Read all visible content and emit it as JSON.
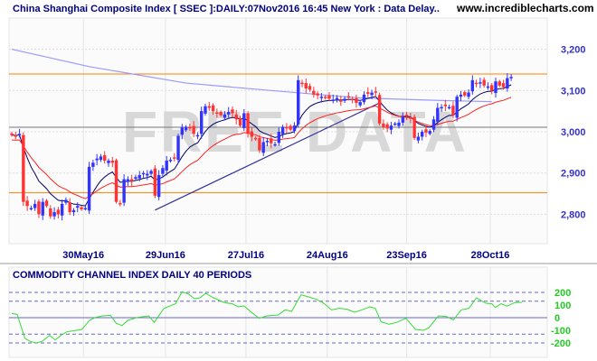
{
  "header": {
    "title": "China Shanghai Composite Index [ SSEC ]:DAILY:07Nov2016 16:45 New York : Data Delay..",
    "site": "www.incrediblecharts.com"
  },
  "watermark": "FREE DATA",
  "colors": {
    "up": "#3333ff",
    "down": "#ff3333",
    "ema_fast": "#000066",
    "ema_slow": "#ff2222",
    "ma_long": "#9999ff",
    "hline": "#ff8000",
    "trend": "#333399",
    "cci": "#33dd33"
  },
  "chart_data": [
    {
      "type": "candlestick",
      "title": "China Shanghai Composite Index [ SSEC ]:DAILY",
      "ylim": [
        2740,
        3260
      ],
      "yticks": [
        {
          "v": 2800,
          "label": "2,800"
        },
        {
          "v": 2900,
          "label": "2,900"
        },
        {
          "v": 3000,
          "label": "3,000"
        },
        {
          "v": 3100,
          "label": "3,100"
        },
        {
          "v": 3200,
          "label": "3,200"
        }
      ],
      "xticks": [
        {
          "bar": 18.5,
          "label": "30May16"
        },
        {
          "bar": 39.7,
          "label": "29Jun16"
        },
        {
          "bar": 60.5,
          "label": "27Jul16"
        },
        {
          "bar": 81.5,
          "label": "24Aug16"
        },
        {
          "bar": 102,
          "label": "23Sep16"
        },
        {
          "bar": 123.6,
          "label": "28Oct16"
        }
      ],
      "close": [
        2992,
        2988,
        2995,
        2830,
        2820,
        2815,
        2825,
        2800,
        2830,
        2820,
        2795,
        2805,
        2800,
        2825,
        2835,
        2805,
        2810,
        2820,
        2812,
        2815,
        2915,
        2925,
        2935,
        2940,
        2930,
        2930,
        2925,
        2830,
        2825,
        2885,
        2885,
        2880,
        2890,
        2895,
        2900,
        2898,
        2905,
        2845,
        2895,
        2912,
        2930,
        2932,
        2935,
        2990,
        3010,
        3012,
        3008,
        2995,
        2992,
        3050,
        3062,
        3058,
        3050,
        3045,
        3040,
        3042,
        3048,
        3045,
        3030,
        3015,
        3045,
        2995,
        2988,
        2982,
        2955,
        2975,
        2978,
        2972,
        2970,
        3000,
        3012,
        3008,
        3005,
        3015,
        3125,
        3118,
        3105,
        3102,
        3090,
        3088,
        3085,
        3082,
        3080,
        3078,
        3082,
        3075,
        3080,
        3083,
        3078,
        3070,
        3072,
        3090,
        3092,
        3095,
        3095,
        3020,
        3012,
        3008,
        3015,
        3020,
        3022,
        3035,
        3038,
        3033,
        2985,
        2988,
        3000,
        2998,
        3002,
        3030,
        3058,
        3060,
        3062,
        3060,
        3040,
        3085,
        3090,
        3088,
        3095,
        3125,
        3118,
        3120,
        3112,
        3110,
        3100,
        3122,
        3112,
        3108,
        3130,
        3133
      ],
      "ma_long": [
        [
          0,
          3200
        ],
        [
          20,
          3158
        ],
        [
          45,
          3118
        ],
        [
          67,
          3100
        ],
        [
          90,
          3082
        ],
        [
          110,
          3076
        ],
        [
          124,
          3073
        ]
      ],
      "horizontal_lines": [
        3140,
        3011,
        2852
      ],
      "trend_line": [
        [
          37,
          2810
        ],
        [
          95,
          3070
        ]
      ]
    },
    {
      "type": "line",
      "title": "COMMODITY CHANNEL INDEX DAILY 40 PERIODS",
      "ylim": [
        -260,
        260
      ],
      "yticks": [
        {
          "v": 200,
          "label": "200"
        },
        {
          "v": 100,
          "label": "100"
        },
        {
          "v": 0,
          "label": "0"
        },
        {
          "v": -100,
          "label": "-100"
        },
        {
          "v": -200,
          "label": "-200"
        }
      ],
      "dashed_levels": [
        200,
        130,
        -130,
        -200
      ],
      "points": [
        [
          0,
          33
        ],
        [
          1.4,
          26
        ],
        [
          3.4,
          -164
        ],
        [
          4.8,
          -188
        ],
        [
          6.3,
          -200
        ],
        [
          7.8,
          -188
        ],
        [
          9.8,
          -140
        ],
        [
          11.2,
          -176
        ],
        [
          12.7,
          -140
        ],
        [
          14.2,
          -112
        ],
        [
          16.7,
          -100
        ],
        [
          18.1,
          -93
        ],
        [
          20.1,
          -21
        ],
        [
          21.6,
          2
        ],
        [
          23.5,
          14
        ],
        [
          25.5,
          19
        ],
        [
          27,
          -45
        ],
        [
          28.5,
          -62
        ],
        [
          30,
          -21
        ],
        [
          32.4,
          2
        ],
        [
          35.4,
          14
        ],
        [
          36.8,
          -38
        ],
        [
          39.3,
          74
        ],
        [
          42.3,
          110
        ],
        [
          44,
          205
        ],
        [
          45.7,
          186
        ],
        [
          47.2,
          150
        ],
        [
          48.6,
          157
        ],
        [
          50.1,
          193
        ],
        [
          52.1,
          157
        ],
        [
          55,
          119
        ],
        [
          57,
          110
        ],
        [
          58.5,
          86
        ],
        [
          60,
          93
        ],
        [
          61.9,
          43
        ],
        [
          63.9,
          -5
        ],
        [
          65.9,
          14
        ],
        [
          68.8,
          21
        ],
        [
          70.6,
          62
        ],
        [
          72.3,
          50
        ],
        [
          74.7,
          181
        ],
        [
          76.2,
          169
        ],
        [
          78.7,
          145
        ],
        [
          80.6,
          114
        ],
        [
          82.6,
          62
        ],
        [
          84.6,
          74
        ],
        [
          86.6,
          67
        ],
        [
          88.5,
          43
        ],
        [
          90.5,
          62
        ],
        [
          92.5,
          86
        ],
        [
          93.9,
          74
        ],
        [
          95.4,
          -33
        ],
        [
          97.4,
          -52
        ],
        [
          99.4,
          -38
        ],
        [
          101.8,
          -5
        ],
        [
          104.3,
          -93
        ],
        [
          106.3,
          -100
        ],
        [
          107.7,
          -81
        ],
        [
          110.2,
          14
        ],
        [
          112.2,
          10
        ],
        [
          114.1,
          -17
        ],
        [
          116.1,
          62
        ],
        [
          118.1,
          74
        ],
        [
          120,
          157
        ],
        [
          122.5,
          114
        ],
        [
          124,
          110
        ],
        [
          124.9,
          81
        ],
        [
          126.4,
          110
        ],
        [
          127.9,
          91
        ],
        [
          129.9,
          119
        ],
        [
          131.8,
          121
        ]
      ]
    }
  ]
}
